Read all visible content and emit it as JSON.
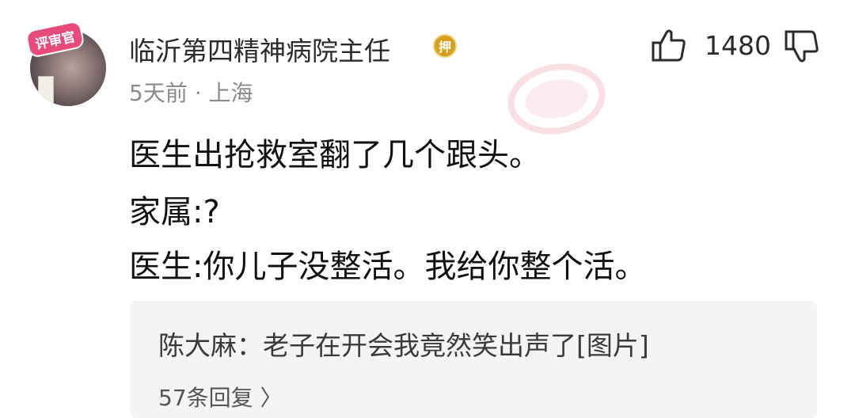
{
  "user": {
    "name": "临沂第四精神病院主任",
    "badge_text": "评审官",
    "verified_glyph": "押"
  },
  "meta": {
    "time_location": "5天前 · 上海"
  },
  "reactions": {
    "like_count": "1480",
    "like_icon": "thumbs-up-icon",
    "dislike_icon": "thumbs-down-icon"
  },
  "comment": {
    "lines": [
      "医生出抢救室翻了几个跟头。",
      "家属:?",
      "医生:你儿子没整活。我给你整个活。"
    ]
  },
  "reply_preview": {
    "text": "陈大麻：老子在开会我竟然笑出声了[图片]",
    "count_label": "57条回复 〉"
  },
  "colors": {
    "badge": "#e74a7b",
    "verified": "#d6a01e",
    "reply_bg": "#f4f4f4",
    "meta_text": "#8a8a8a"
  }
}
